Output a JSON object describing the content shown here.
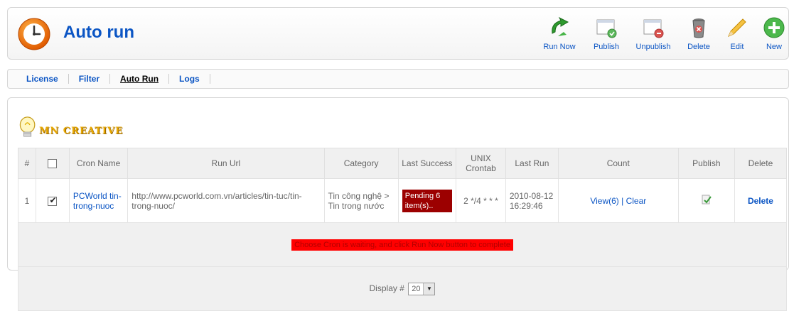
{
  "header": {
    "title": "Auto run",
    "logo_icon": "clock-icon"
  },
  "toolbar": [
    {
      "label": "Run Now",
      "icon": "run-now-icon",
      "name": "run-now-button"
    },
    {
      "label": "Publish",
      "icon": "publish-icon",
      "name": "publish-button"
    },
    {
      "label": "Unpublish",
      "icon": "unpublish-icon",
      "name": "unpublish-button"
    },
    {
      "label": "Delete",
      "icon": "trash-icon",
      "name": "delete-button"
    },
    {
      "label": "Edit",
      "icon": "pencil-icon",
      "name": "edit-button"
    },
    {
      "label": "New",
      "icon": "plus-icon",
      "name": "new-button"
    }
  ],
  "tabs": [
    {
      "label": "License",
      "active": false
    },
    {
      "label": "Filter",
      "active": false
    },
    {
      "label": "Auto Run",
      "active": true
    },
    {
      "label": "Logs",
      "active": false
    }
  ],
  "brand": {
    "text": "MN CREATIVE",
    "icon": "lightbulb-icon"
  },
  "table": {
    "headers": {
      "num": "#",
      "cron_name": "Cron Name",
      "run_url": "Run Url",
      "category": "Category",
      "last_success": "Last Success",
      "unix_crontab": "UNIX Crontab",
      "last_run": "Last Run",
      "count": "Count",
      "publish": "Publish",
      "delete": "Delete"
    },
    "rows": [
      {
        "num": "1",
        "checked": true,
        "cron_name": "PCWorld tin-trong-nuoc",
        "run_url": "http://www.pcworld.com.vn/articles/tin-tuc/tin-trong-nuoc/",
        "category": "Tin công nghệ > Tin trong nước",
        "last_success": "Pending 6 item(s)..",
        "unix_crontab": "2 */4 * * *",
        "last_run_date": "2010-08-12",
        "last_run_time": "16:29:46",
        "count_view": "View(6)",
        "count_sep": " | ",
        "count_clear": "Clear",
        "publish_icon": "published-check-icon",
        "delete_label": "Delete"
      }
    ],
    "notice": "Choose Cron is waiting, and click Run Now button to complete",
    "display_label": "Display #",
    "display_value": "20"
  },
  "colors": {
    "link": "#0b55c4",
    "pending_bg": "#9c0000",
    "notice_bg": "#ff0000"
  }
}
